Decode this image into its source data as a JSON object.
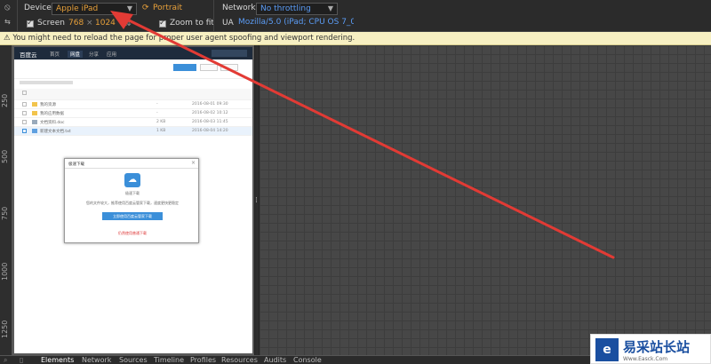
{
  "toolbar": {
    "device_label": "Device",
    "device_value": "Apple iPad",
    "portrait_label": "Portrait",
    "screen_label": "Screen",
    "screen_width": "768",
    "screen_x": "×",
    "screen_height": "1024",
    "zoom_label": "Zoom to fit",
    "network_label": "Network",
    "network_value": "No throttling",
    "ua_label": "UA",
    "ua_value": "Mozilla/5.0 (iPad; CPU OS 7_0 ...",
    "dock_icon": "block-icon",
    "menu_icon": "drawer-icon"
  },
  "warning": "⚠ You might need to reload the page for proper user agent spoofing and viewport rendering.",
  "ruler": [
    "250",
    "500",
    "750",
    "1000",
    "1250"
  ],
  "page": {
    "logo": "百度云",
    "nav": [
      "首页",
      "网盘",
      "分享",
      "应用"
    ],
    "rows": [
      {
        "name": "我的资源",
        "size": "-",
        "date": "2016-08-01 09:30"
      },
      {
        "name": "我的应用数据",
        "size": "-",
        "date": "2016-08-02 10:12"
      },
      {
        "name": "文档资料.doc",
        "size": "2 KB",
        "date": "2016-08-03 11:45"
      },
      {
        "name": "新建文本文档.txt",
        "size": "1 KB",
        "date": "2016-08-04 14:20"
      }
    ],
    "dialog": {
      "title": "极速下载",
      "close": "×",
      "line1": "极速下载",
      "line2": "您的文件较大，推荐使用百度云管家下载，速度更快更稳定",
      "button": "立即使用百度云管家下载",
      "link": "仍然使用普通下载"
    }
  },
  "bottom_tabs": [
    "Elements",
    "Network",
    "Sources",
    "Timeline",
    "Profiles",
    "Resources",
    "Audits",
    "Console"
  ],
  "watermark": {
    "title": "易采站长站",
    "url": "Www.Easck.Com"
  }
}
